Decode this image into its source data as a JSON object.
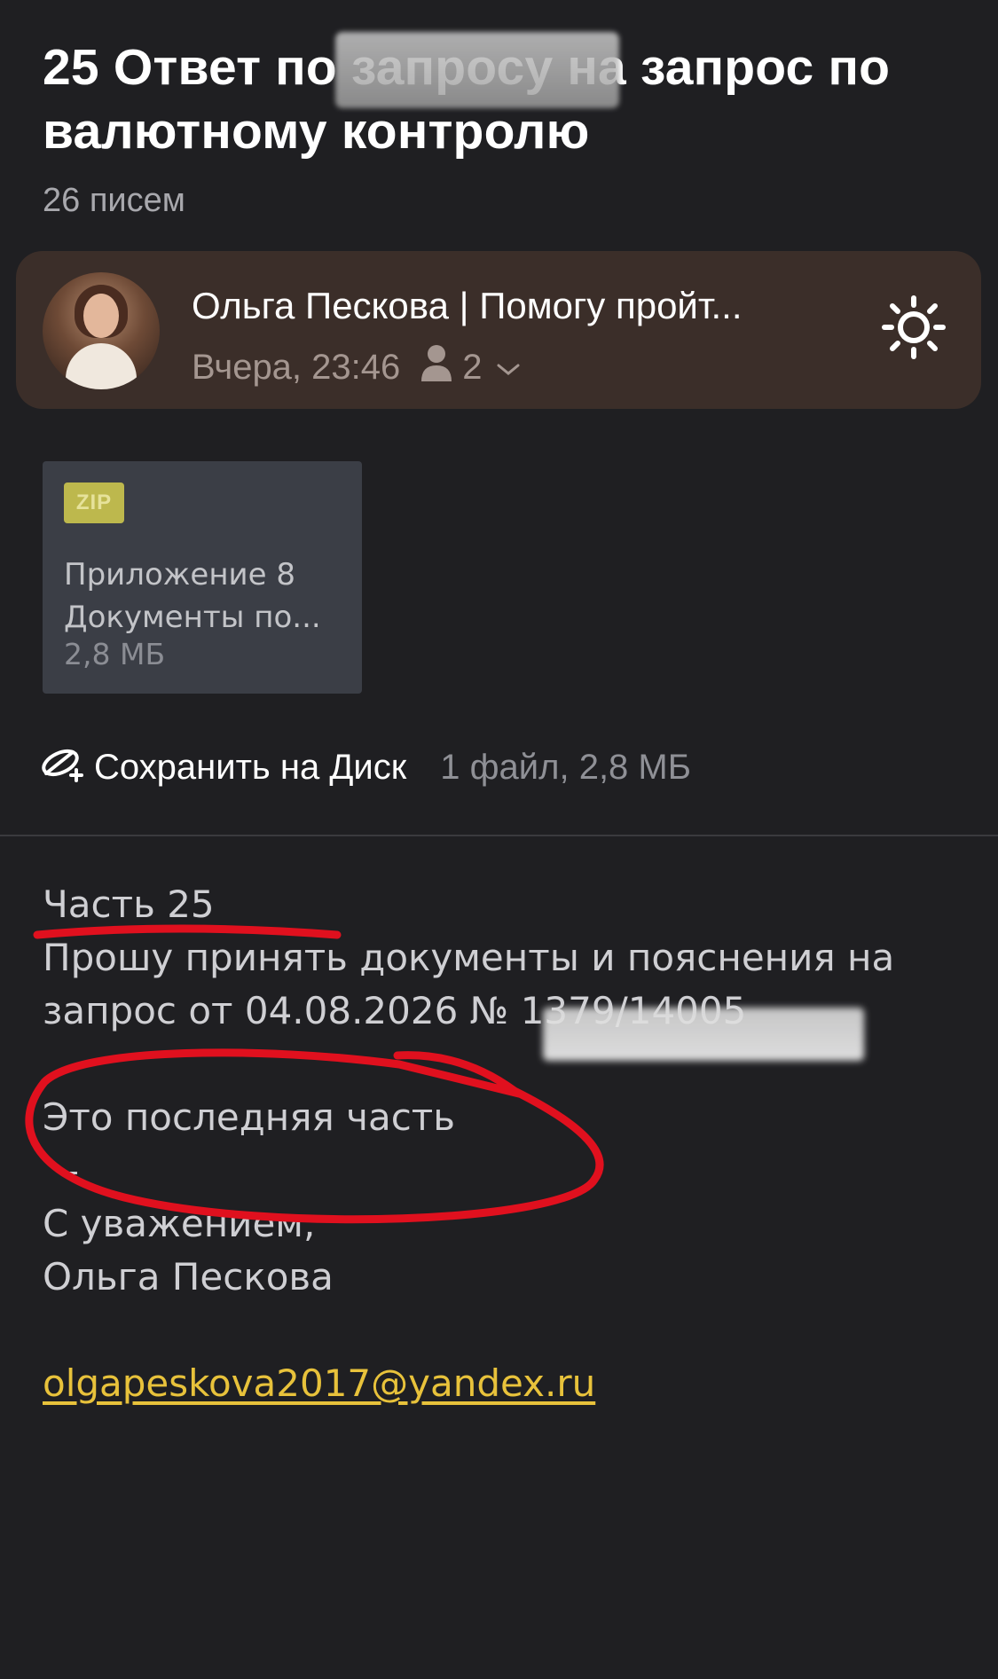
{
  "thread": {
    "title": "25 Ответ по запросу на запрос по валютному контролю",
    "count": "26 писем"
  },
  "message": {
    "sender": "Ольга Пескова | Помогу пройт...",
    "time": "Вчера, 23:46",
    "recipients_count": "2"
  },
  "attachment": {
    "type_badge": "ZIP",
    "name_line1": "Приложение 8",
    "name_line2": "Документы по...",
    "size": "2,8 МБ"
  },
  "save": {
    "label": "Сохранить на Диск",
    "info": "1 файл, 2,8 МБ"
  },
  "body": {
    "line1": "Часть 25",
    "line2": "Прошу принять документы и пояснения на",
    "line3": "запрос от 04.08.2026 № 1379/14005",
    "line4": "Это последняя часть",
    "line5": "–",
    "line6": "С уважением,",
    "line7": "Ольга Пескова",
    "email": "olgapeskova2017@yandex.ru"
  },
  "icons": {
    "theme": "sun-icon",
    "recipients": "person-icon",
    "expand": "chevron-down-icon",
    "disk": "disk-save-icon"
  },
  "colors": {
    "background": "#1f1f22",
    "card": "#3b2e29",
    "zip_badge": "#bdb84d",
    "link": "#e8c23b",
    "annotation": "#e0101e"
  }
}
